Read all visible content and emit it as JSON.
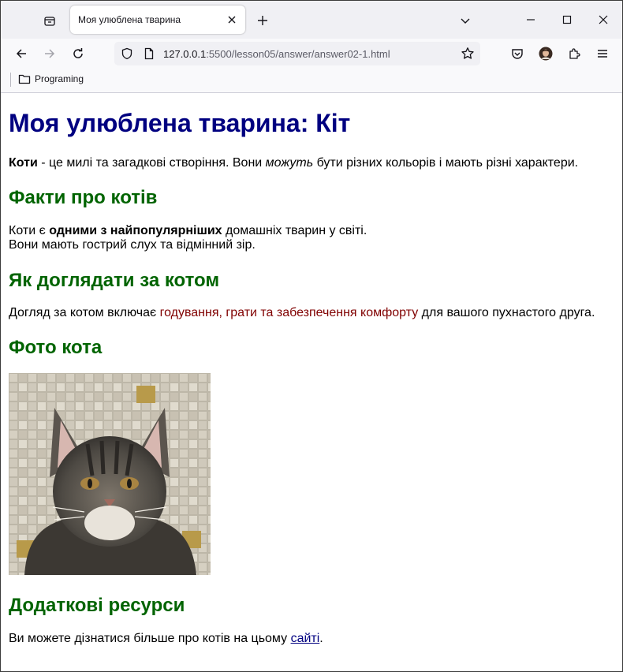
{
  "browser": {
    "tab_title": "Моя улюблена тварина",
    "url_host": "127.0.0.1",
    "url_rest": ":5500/lesson05/answer/answer02-1.html",
    "bookmark_folder": "Programing"
  },
  "content": {
    "h1": "Моя улюблена тварина: Кіт",
    "intro_bold": "Коти",
    "intro_1": " - це милі та загадкові створіння. Вони ",
    "intro_em": "можуть",
    "intro_2": " бути різних кольорів і мають різні характери.",
    "h_facts": "Факти про котів",
    "facts_1": "Коти є ",
    "facts_bold": "одними з найпопулярніших",
    "facts_2": " домашніх тварин у світі.",
    "facts_line2": "Вони мають гострий слух та відмінний зір.",
    "h_care": "Як доглядати за котом",
    "care_1": "Догляд за котом включає ",
    "care_hl": "годування, грати та забезпечення комфорту",
    "care_2": " для вашого пухнастого друга.",
    "h_photo": "Фото кота",
    "h_resources": "Додаткові ресурси",
    "res_1": "Ви можете дізнатися більше про котів на цьому ",
    "res_link": "сайті",
    "res_2": "."
  },
  "colors": {
    "h1": "#000080",
    "h2": "#006400",
    "highlight": "#800000"
  }
}
